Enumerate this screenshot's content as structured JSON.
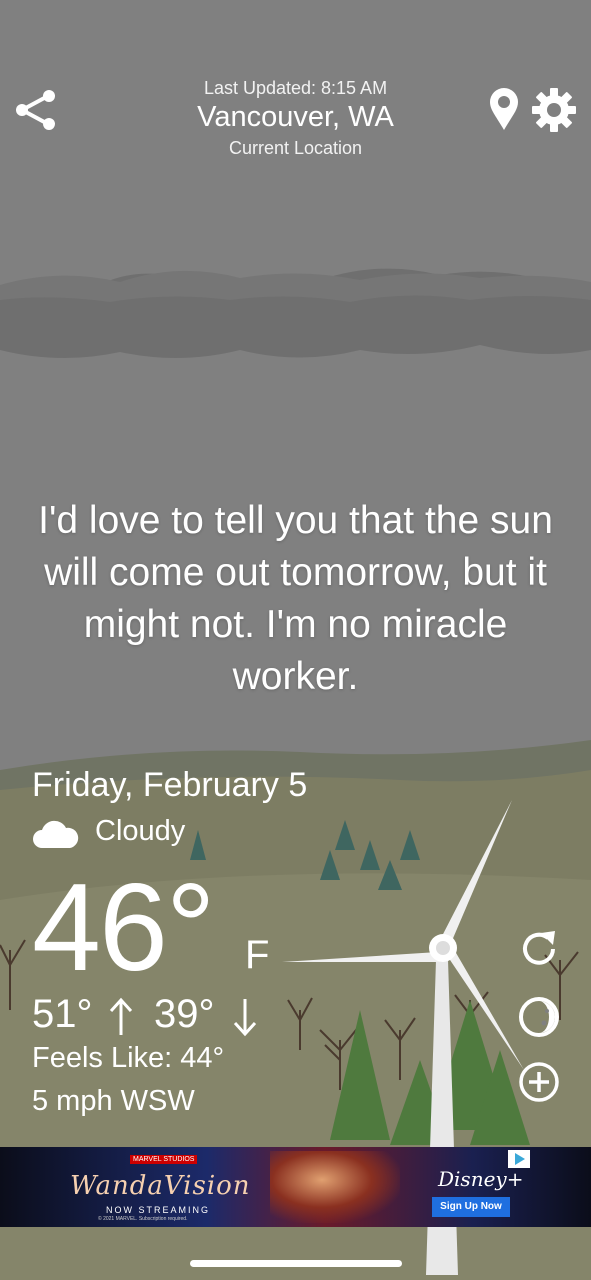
{
  "header": {
    "last_updated": "Last Updated: 8:15 AM",
    "city": "Vancouver, WA",
    "location_label": "Current Location",
    "share_icon": "share-icon",
    "pin_icon": "location-pin-icon",
    "settings_icon": "gear-icon"
  },
  "quote": "I'd love to tell you that the sun will come out tomorrow, but it might not. I'm no miracle worker.",
  "weather": {
    "date": "Friday, February 5",
    "condition": "Cloudy",
    "condition_icon": "cloud-icon",
    "temperature": "46°",
    "unit": "F",
    "high": "51°",
    "low": "39°",
    "feels_like": "Feels Like: 44°",
    "wind": "5 mph WSW"
  },
  "side_buttons": [
    {
      "icon": "refresh-icon"
    },
    {
      "icon": "moon-icon"
    },
    {
      "icon": "add-icon"
    }
  ],
  "ad": {
    "studio": "MARVEL STUDIOS",
    "title": "WandaVision",
    "tagline": "NOW STREAMING",
    "fineprint": "© 2021 MARVEL. Subscription required.",
    "brand": "Disney+",
    "cta": "Sign Up Now"
  },
  "colors": {
    "sky": "#808080",
    "hill_far": "#6e7660",
    "ground": "#8a8a6a",
    "tree_green": "#4f7a3e",
    "ad_cta": "#1f6fe0"
  }
}
